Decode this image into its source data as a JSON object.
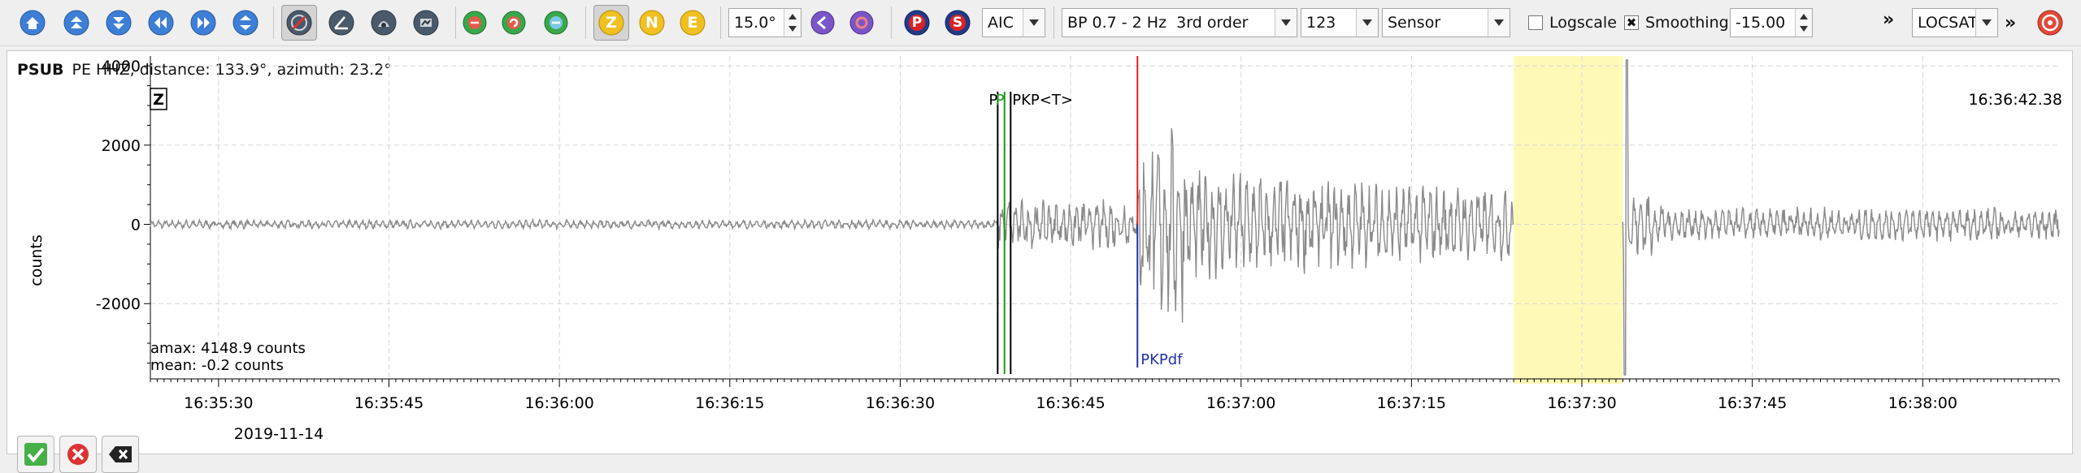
{
  "toolbar": {
    "nav_buttons": [
      {
        "name": "home-icon"
      },
      {
        "name": "scroll-up-icon"
      },
      {
        "name": "scroll-down-icon"
      },
      {
        "name": "scroll-left-icon"
      },
      {
        "name": "scroll-right-icon"
      },
      {
        "name": "zoom-fit-icon"
      }
    ],
    "tool_buttons": [
      {
        "name": "no-rotation-icon",
        "pressed": true
      },
      {
        "name": "rotate-zrt-icon",
        "pressed": false
      },
      {
        "name": "rotate-lqt-icon",
        "pressed": false
      },
      {
        "name": "rotate-zne-icon",
        "pressed": false
      }
    ],
    "filter_buttons": [
      {
        "name": "filter-toggle-icon"
      },
      {
        "name": "filter-cycle-icon"
      },
      {
        "name": "filter-integrate-icon"
      }
    ],
    "components": [
      {
        "label": "Z",
        "name": "component-z-button",
        "pressed": true
      },
      {
        "label": "N",
        "name": "component-n-button",
        "pressed": false
      },
      {
        "label": "E",
        "name": "component-e-button",
        "pressed": false
      }
    ],
    "azimuth_value": "15.0°",
    "arrow_buttons": [
      {
        "name": "rotate-left-icon"
      },
      {
        "name": "rotate-right-icon"
      }
    ],
    "pick_buttons": [
      {
        "label": "P",
        "name": "pick-p-button"
      },
      {
        "label": "S",
        "name": "pick-s-button"
      }
    ],
    "picker_value": "AIC",
    "filter_value": "BP 0.7 - 2 Hz  3rd order",
    "extra_value": "123",
    "sensor_value": "Sensor",
    "logscale_label": "Logscale",
    "logscale_checked": false,
    "smoothing_label": "Smoothing",
    "smoothing_checked": true,
    "smoothing_value": "-15.00",
    "overflow_label": "»",
    "locator_value": "LOCSAT",
    "overflow2_label": "»"
  },
  "panel": {
    "station": "PSUB",
    "info": "PE  HHZ, distance: 133.9°, azimuth: 23.2°",
    "component_label": "Z",
    "top_time": "16:36:42.38",
    "amax": "amax: 4148.9 counts",
    "mean": "mean: -0.2 counts",
    "ylabel": "counts",
    "date": "2019-11-14",
    "picks": [
      {
        "label": "P",
        "color": "#000000",
        "t": 124.3
      },
      {
        "label": "P",
        "color": "#1a9a1a",
        "t": 125.3
      },
      {
        "label": "PKP<T>",
        "color": "#000000",
        "t": 126.2
      }
    ],
    "red_marker_t": 144.8,
    "pkpdf": {
      "label": "PKPdf",
      "color": "#2233aa",
      "t": 144.8
    },
    "highlight": {
      "start": 200,
      "end": 216
    },
    "accept_button": "accept-icon",
    "reject_button": "reject-icon",
    "remove_button": "remove-icon"
  },
  "chart_data": {
    "type": "line",
    "ylabel": "counts",
    "ylim": [
      -3900,
      4250
    ],
    "yticks": [
      4000,
      2000,
      0,
      -2000
    ],
    "xlim": [
      0,
      280
    ],
    "xticks": [
      {
        "t": 10,
        "label": "16:35:30"
      },
      {
        "t": 35,
        "label": "16:35:45"
      },
      {
        "t": 60,
        "label": "16:36:00"
      },
      {
        "t": 85,
        "label": "16:36:15"
      },
      {
        "t": 110,
        "label": "16:36:30"
      },
      {
        "t": 135,
        "label": "16:36:45"
      },
      {
        "t": 160,
        "label": "16:37:00"
      },
      {
        "t": 185,
        "label": "16:37:15"
      },
      {
        "t": 210,
        "label": "16:37:30"
      },
      {
        "t": 235,
        "label": "16:37:45"
      },
      {
        "t": 260,
        "label": "16:38:00"
      }
    ],
    "grid": true,
    "series": [
      {
        "name": "",
        "color": "#8a8a8a"
      }
    ]
  }
}
